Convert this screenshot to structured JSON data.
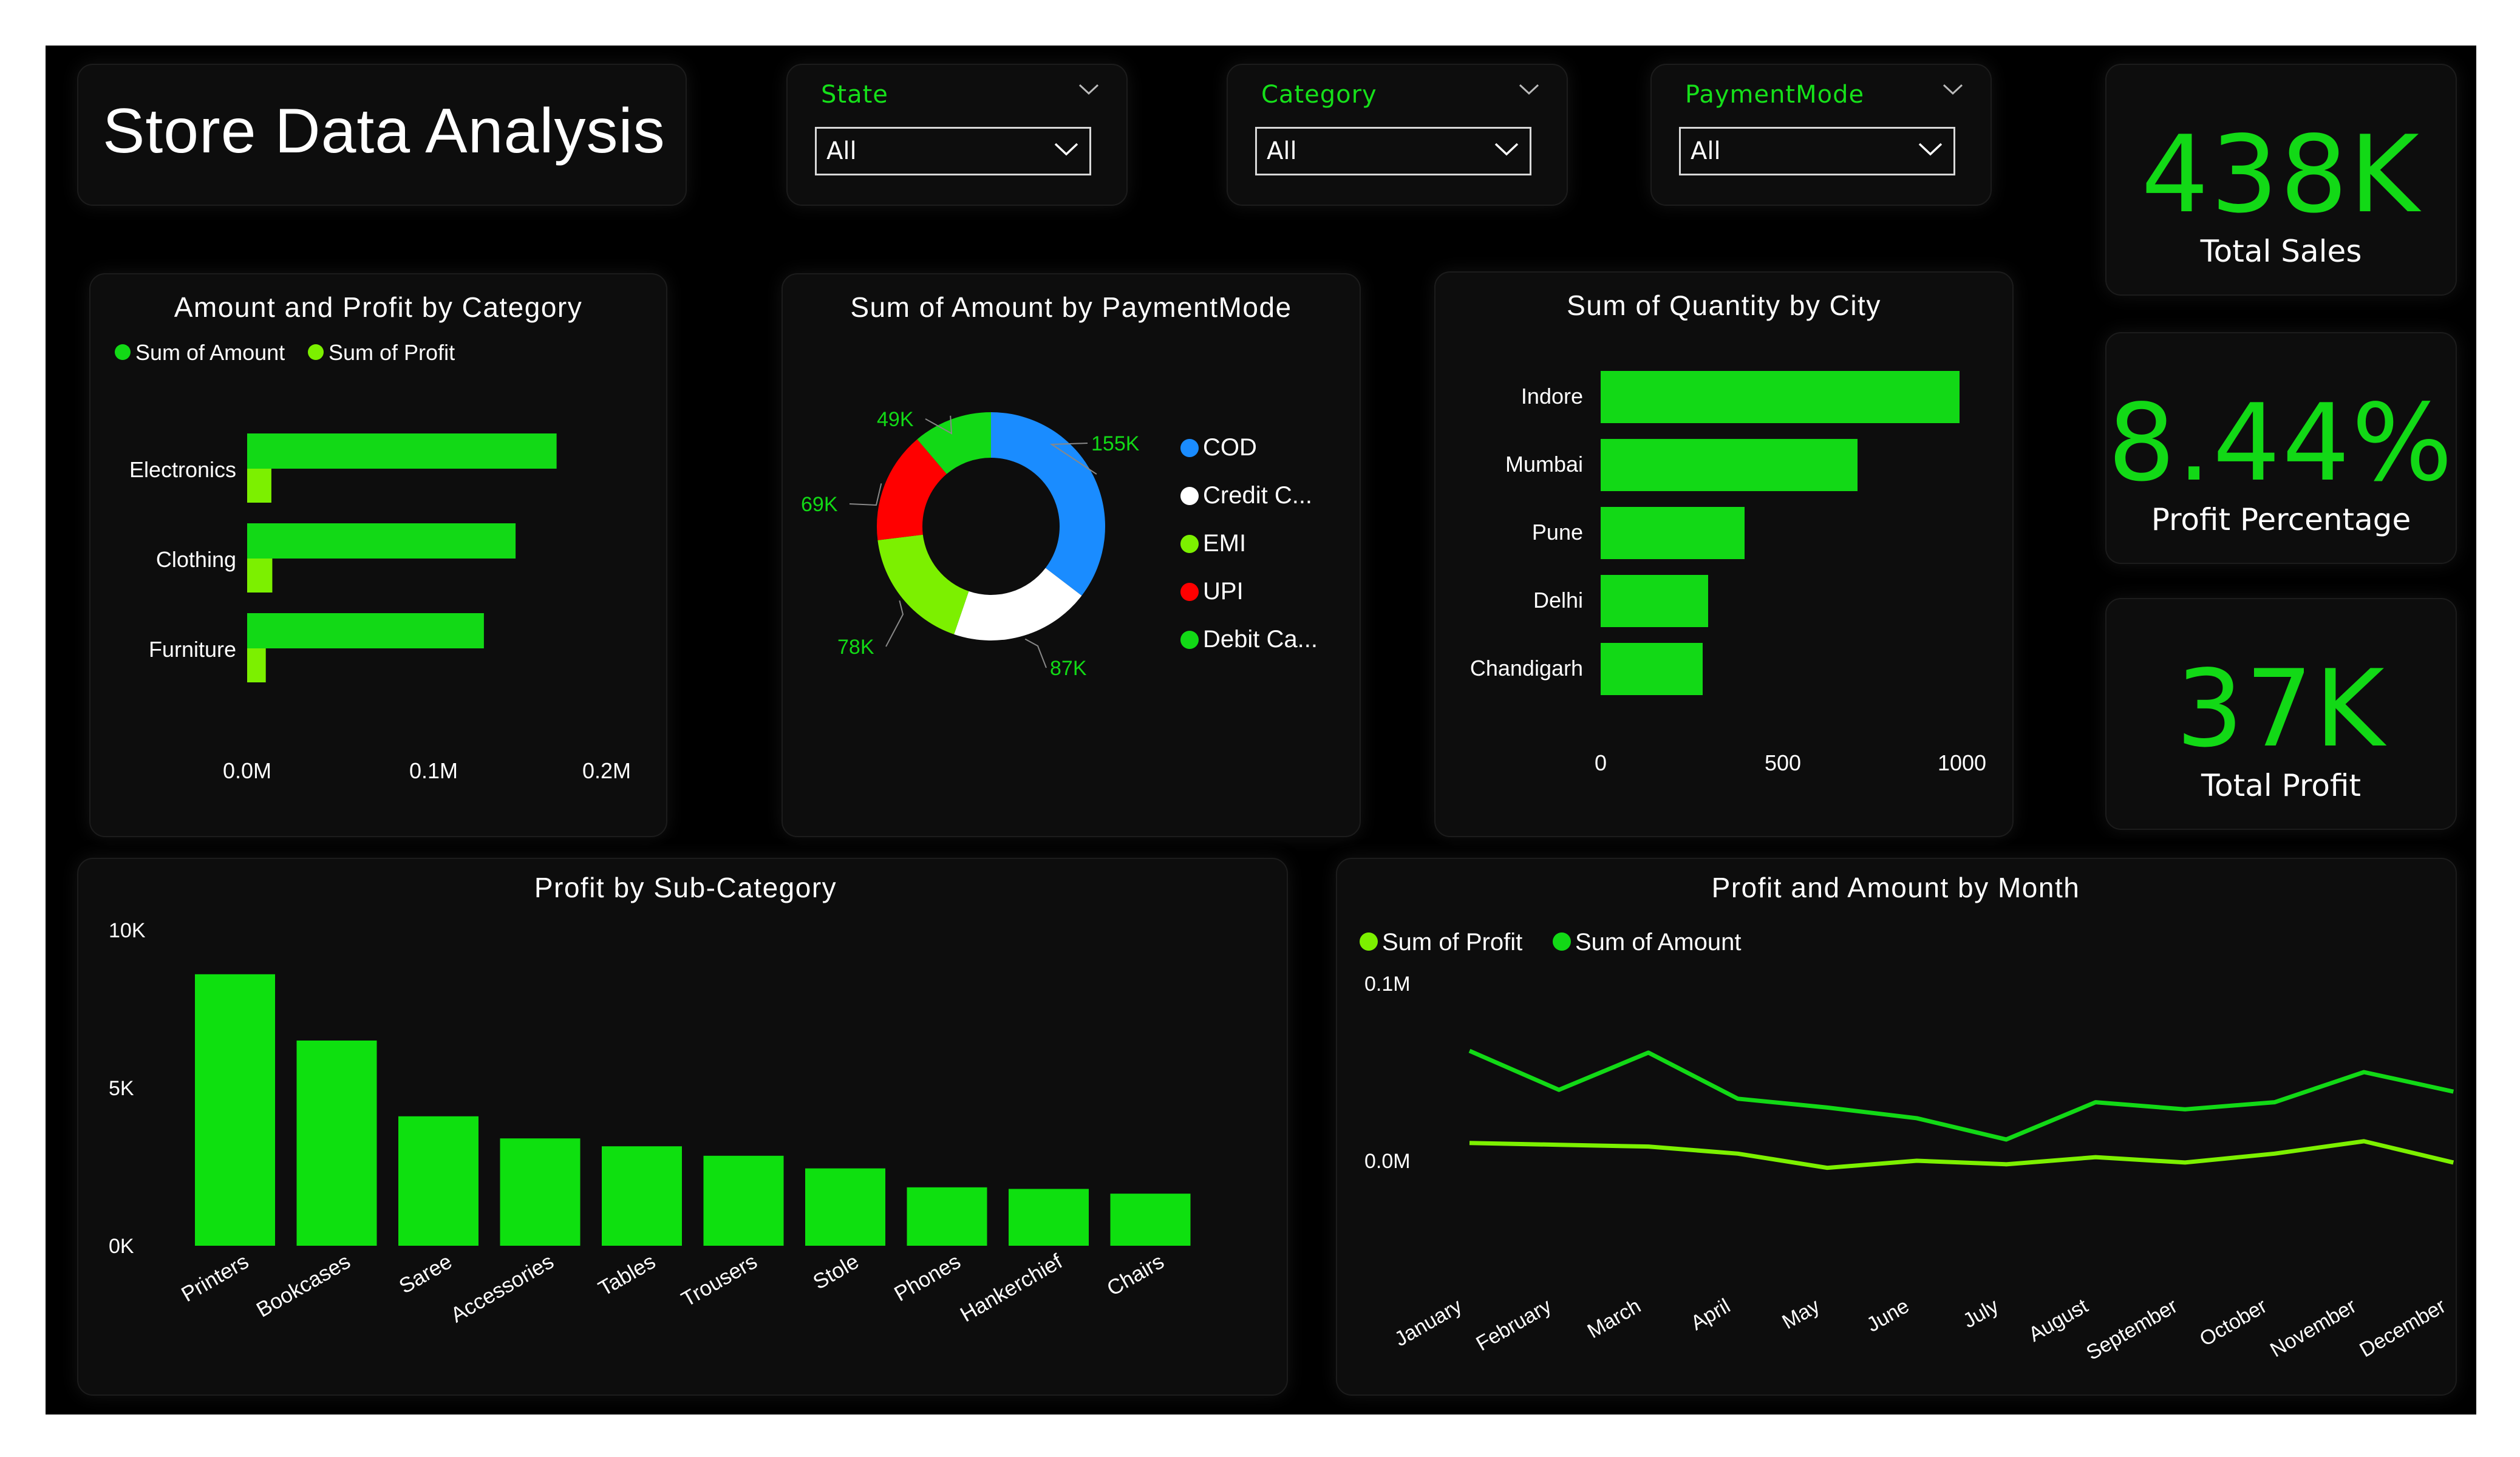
{
  "dashboard_title": "Store Data Analysis",
  "colors": {
    "accent": "#12d916",
    "lime": "#7cf000",
    "blue": "#1a8cff",
    "red": "#ff0000",
    "white": "#ffffff"
  },
  "slicers": [
    {
      "label": "State",
      "value": "All"
    },
    {
      "label": "Category",
      "value": "All"
    },
    {
      "label": "PaymentMode",
      "value": "All"
    }
  ],
  "kpis": [
    {
      "value": "438K",
      "label": "Total Sales"
    },
    {
      "value": "8.44%",
      "label": "Profit Percentage"
    },
    {
      "value": "37K",
      "label": "Total Profit"
    }
  ],
  "chart_data": [
    {
      "id": "category",
      "type": "bar",
      "orientation": "horizontal",
      "title": "Amount and Profit by Category",
      "categories": [
        "Electronics",
        "Clothing",
        "Furniture"
      ],
      "series": [
        {
          "name": "Sum of Amount",
          "values": [
            166000,
            144000,
            127000
          ],
          "color": "#12d916"
        },
        {
          "name": "Sum of Profit",
          "values": [
            13000,
            13500,
            10000
          ],
          "color": "#7cf000"
        }
      ],
      "ticks": [
        "0.0M",
        "0.1M",
        "0.2M"
      ],
      "xlim": [
        0,
        200000
      ],
      "legend": "top-left"
    },
    {
      "id": "payment",
      "type": "pie",
      "donut": true,
      "title": "Sum of Amount by PaymentMode",
      "categories": [
        "COD",
        "Credit C...",
        "EMI",
        "UPI",
        "Debit Ca..."
      ],
      "values": [
        155,
        87,
        78,
        69,
        49
      ],
      "labels": [
        "155K",
        "87K",
        "78K",
        "69K",
        "49K"
      ],
      "colors": [
        "#1a8cff",
        "#ffffff",
        "#7cf000",
        "#ff0000",
        "#12d916"
      ],
      "legend": "right"
    },
    {
      "id": "city",
      "type": "bar",
      "orientation": "horizontal",
      "title": "Sum of Quantity by City",
      "categories": [
        "Indore",
        "Mumbai",
        "Pune",
        "Delhi",
        "Chandigarh"
      ],
      "values": [
        985,
        705,
        395,
        295,
        280
      ],
      "ticks": [
        "0",
        "500",
        "1000"
      ],
      "xlim": [
        0,
        1000
      ]
    },
    {
      "id": "subcategory",
      "type": "bar",
      "title": "Profit by Sub-Category",
      "categories": [
        "Printers",
        "Bookcases",
        "Saree",
        "Accessories",
        "Tables",
        "Trousers",
        "Stole",
        "Phones",
        "Hankerchief",
        "Chairs"
      ],
      "values": [
        8600,
        6500,
        4100,
        3400,
        3150,
        2850,
        2450,
        1850,
        1800,
        1650
      ],
      "ticks": [
        "0K",
        "5K",
        "10K"
      ],
      "ylim": [
        0,
        10000
      ]
    },
    {
      "id": "monthly",
      "type": "line",
      "title": "Profit and Amount by Month",
      "categories": [
        "January",
        "February",
        "March",
        "April",
        "May",
        "June",
        "July",
        "August",
        "September",
        "October",
        "November",
        "December"
      ],
      "series": [
        {
          "name": "Sum of Profit",
          "values": [
            10000,
            9000,
            8000,
            4000,
            -4000,
            0,
            -2000,
            2000,
            -1000,
            4000,
            11000,
            -1000
          ],
          "color": "#7cf000"
        },
        {
          "name": "Sum of Amount",
          "values": [
            62000,
            40000,
            61000,
            35000,
            30000,
            24000,
            12000,
            33000,
            29000,
            33000,
            50000,
            39000
          ],
          "color": "#12d916"
        }
      ],
      "ticks": [
        "0.0M",
        "0.1M"
      ],
      "ylim": [
        0,
        100000
      ],
      "legend": "top-left"
    }
  ]
}
